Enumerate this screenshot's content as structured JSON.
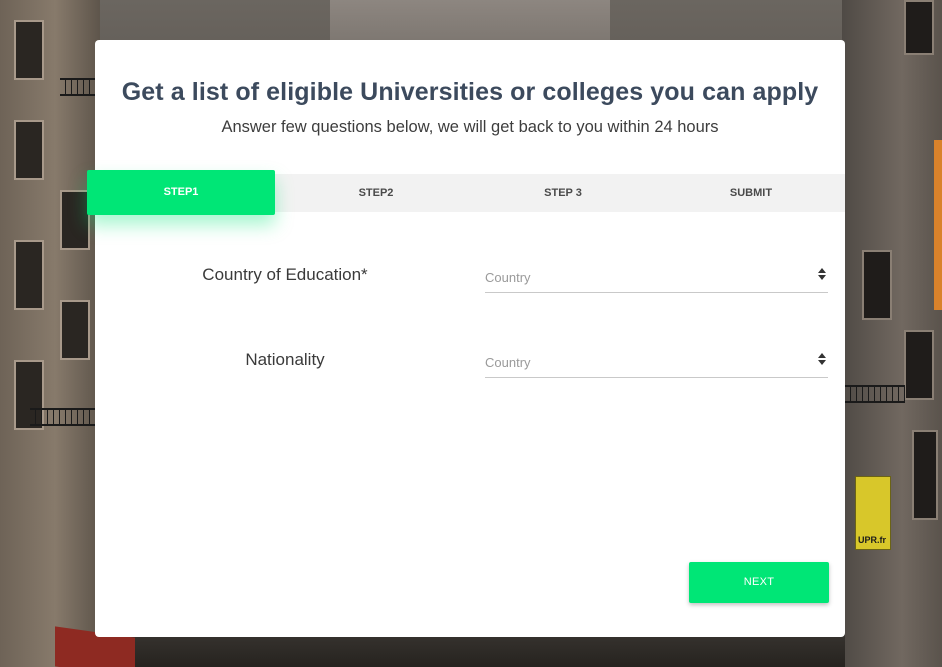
{
  "page": {
    "title": "Get a list of eligible Universities or colleges you can apply",
    "subtitle": "Answer few questions below, we will get back to you within 24 hours"
  },
  "steps": {
    "items": [
      {
        "label": "STEP1",
        "active": true
      },
      {
        "label": "STEP2",
        "active": false
      },
      {
        "label": "STEP 3",
        "active": false
      },
      {
        "label": "SUBMIT",
        "active": false
      }
    ]
  },
  "form": {
    "country_of_education": {
      "label": "Country of Education*",
      "placeholder": "Country"
    },
    "nationality": {
      "label": "Nationality",
      "placeholder": "Country"
    }
  },
  "actions": {
    "next_label": "NEXT"
  },
  "background": {
    "poster_text": "UPR.fr"
  },
  "colors": {
    "accent": "#00e676",
    "title": "#3c4a5d",
    "step_bar": "#f2f2f2"
  }
}
